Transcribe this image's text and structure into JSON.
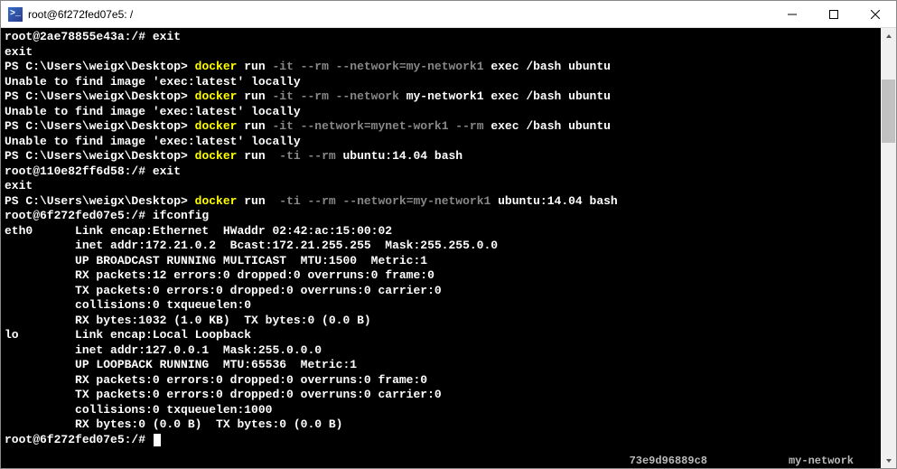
{
  "titlebar": {
    "icon_label": ">_",
    "title": "root@6f272fed07e5: /"
  },
  "lines": [
    [
      {
        "cls": "",
        "t": "root@2ae78855e43a:/# exit"
      }
    ],
    [
      {
        "cls": "",
        "t": "exit"
      }
    ],
    [
      {
        "cls": "",
        "t": "PS C:\\Users\\weigx\\Desktop> "
      },
      {
        "cls": "yellow",
        "t": "docker "
      },
      {
        "cls": "",
        "t": "run "
      },
      {
        "cls": "dim",
        "t": "-it --rm --network=my-network1"
      },
      {
        "cls": "",
        "t": " exec /bash ubuntu"
      }
    ],
    [
      {
        "cls": "",
        "t": "Unable to find image 'exec:latest' locally"
      }
    ],
    [
      {
        "cls": "",
        "t": "PS C:\\Users\\weigx\\Desktop> "
      },
      {
        "cls": "yellow",
        "t": "docker "
      },
      {
        "cls": "",
        "t": "run "
      },
      {
        "cls": "dim",
        "t": "-it --rm --network"
      },
      {
        "cls": "",
        "t": " my-network1 exec /bash ubuntu"
      }
    ],
    [
      {
        "cls": "",
        "t": "Unable to find image 'exec:latest' locally"
      }
    ],
    [
      {
        "cls": "",
        "t": "PS C:\\Users\\weigx\\Desktop> "
      },
      {
        "cls": "yellow",
        "t": "docker "
      },
      {
        "cls": "",
        "t": "run "
      },
      {
        "cls": "dim",
        "t": "-it --network=mynet-work1 --rm"
      },
      {
        "cls": "",
        "t": " exec /bash ubuntu"
      }
    ],
    [
      {
        "cls": "",
        "t": "Unable to find image 'exec:latest' locally"
      }
    ],
    [
      {
        "cls": "",
        "t": "PS C:\\Users\\weigx\\Desktop> "
      },
      {
        "cls": "yellow",
        "t": "docker "
      },
      {
        "cls": "",
        "t": "run  "
      },
      {
        "cls": "dim",
        "t": "-ti --rm"
      },
      {
        "cls": "",
        "t": " ubuntu:14.04 bash"
      }
    ],
    [
      {
        "cls": "",
        "t": "root@110e82ff6d58:/# exit"
      }
    ],
    [
      {
        "cls": "",
        "t": "exit"
      }
    ],
    [
      {
        "cls": "",
        "t": "PS C:\\Users\\weigx\\Desktop> "
      },
      {
        "cls": "yellow",
        "t": "docker "
      },
      {
        "cls": "",
        "t": "run  "
      },
      {
        "cls": "dim",
        "t": "-ti --rm --network=my-network1"
      },
      {
        "cls": "",
        "t": " ubuntu:14.04 bash"
      }
    ],
    [
      {
        "cls": "",
        "t": "root@6f272fed07e5:/# ifconfig"
      }
    ],
    [
      {
        "cls": "",
        "t": "eth0      Link encap:Ethernet  HWaddr 02:42:ac:15:00:02"
      }
    ],
    [
      {
        "cls": "",
        "t": "          inet addr:172.21.0.2  Bcast:172.21.255.255  Mask:255.255.0.0"
      }
    ],
    [
      {
        "cls": "",
        "t": "          UP BROADCAST RUNNING MULTICAST  MTU:1500  Metric:1"
      }
    ],
    [
      {
        "cls": "",
        "t": "          RX packets:12 errors:0 dropped:0 overruns:0 frame:0"
      }
    ],
    [
      {
        "cls": "",
        "t": "          TX packets:0 errors:0 dropped:0 overruns:0 carrier:0"
      }
    ],
    [
      {
        "cls": "",
        "t": "          collisions:0 txqueuelen:0"
      }
    ],
    [
      {
        "cls": "",
        "t": "          RX bytes:1032 (1.0 KB)  TX bytes:0 (0.0 B)"
      }
    ],
    [
      {
        "cls": "",
        "t": ""
      }
    ],
    [
      {
        "cls": "",
        "t": "lo        Link encap:Local Loopback"
      }
    ],
    [
      {
        "cls": "",
        "t": "          inet addr:127.0.0.1  Mask:255.0.0.0"
      }
    ],
    [
      {
        "cls": "",
        "t": "          UP LOOPBACK RUNNING  MTU:65536  Metric:1"
      }
    ],
    [
      {
        "cls": "",
        "t": "          RX packets:0 errors:0 dropped:0 overruns:0 frame:0"
      }
    ],
    [
      {
        "cls": "",
        "t": "          TX packets:0 errors:0 dropped:0 overruns:0 carrier:0"
      }
    ],
    [
      {
        "cls": "",
        "t": "          collisions:0 txqueuelen:1000"
      }
    ],
    [
      {
        "cls": "",
        "t": "          RX bytes:0 (0.0 B)  TX bytes:0 (0.0 B)"
      }
    ],
    [
      {
        "cls": "",
        "t": ""
      }
    ],
    [
      {
        "cls": "",
        "t": "root@6f272fed07e5:/#"
      }
    ]
  ],
  "status": {
    "left": "73e9d96889c8",
    "right": "my-network"
  }
}
